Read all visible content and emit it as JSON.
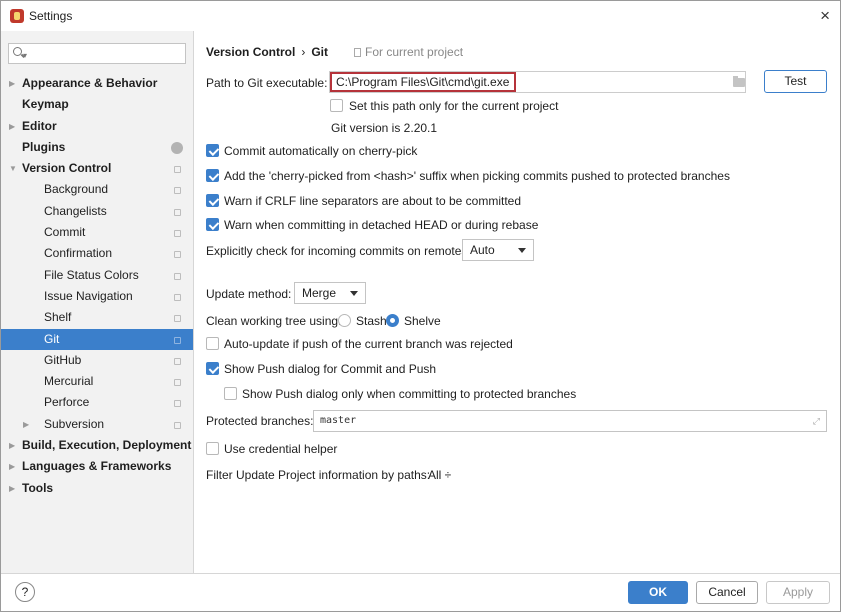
{
  "window": {
    "title": "Settings",
    "close_label": "×"
  },
  "search": {
    "placeholder": ""
  },
  "sidebar": {
    "items": [
      {
        "label": "Appearance & Behavior",
        "level": 0,
        "bold": true,
        "arrow": true
      },
      {
        "label": "Keymap",
        "level": 0,
        "bold": true,
        "arrow": false
      },
      {
        "label": "Editor",
        "level": 0,
        "bold": true,
        "arrow": true
      },
      {
        "label": "Plugins",
        "level": 0,
        "bold": true,
        "arrow": false
      },
      {
        "label": "Version Control",
        "level": 0,
        "bold": true,
        "arrow": true,
        "expanded": true
      },
      {
        "label": "Background",
        "level": 1
      },
      {
        "label": "Changelists",
        "level": 1
      },
      {
        "label": "Commit",
        "level": 1
      },
      {
        "label": "Confirmation",
        "level": 1
      },
      {
        "label": "File Status Colors",
        "level": 1
      },
      {
        "label": "Issue Navigation",
        "level": 1
      },
      {
        "label": "Shelf",
        "level": 1
      },
      {
        "label": "Git",
        "level": 1,
        "selected": true
      },
      {
        "label": "GitHub",
        "level": 1
      },
      {
        "label": "Mercurial",
        "level": 1
      },
      {
        "label": "Perforce",
        "level": 1
      },
      {
        "label": "Subversion",
        "level": 1,
        "arrow": true
      },
      {
        "label": "Build, Execution, Deployment",
        "level": 0,
        "bold": true,
        "arrow": true
      },
      {
        "label": "Languages & Frameworks",
        "level": 0,
        "bold": true,
        "arrow": true
      },
      {
        "label": "Tools",
        "level": 0,
        "bold": true,
        "arrow": true
      }
    ]
  },
  "breadcrumb": {
    "parent": "Version Control",
    "separator": "›",
    "current": "Git",
    "scope": "For current project"
  },
  "git": {
    "path_label": "Path to Git executable:",
    "path_value": "C:\\Program Files\\Git\\cmd\\git.exe",
    "test_button": "Test",
    "project_only_label": "Set this path only for the current project",
    "version_text": "Git version is 2.20.1"
  },
  "options": {
    "commit_cherry_pick": "Commit automatically on cherry-pick",
    "add_cherry_suffix": "Add the 'cherry-picked from <hash>' suffix when picking commits pushed to protected branches",
    "warn_crlf": "Warn if CRLF line separators are about to be committed",
    "warn_detached": "Warn when committing in detached HEAD or during rebase",
    "incoming_label": "Explicitly check for incoming commits on remotes:",
    "incoming_value": "Auto",
    "update_method_label": "Update method:",
    "update_method_value": "Merge",
    "clean_tree_label": "Clean working tree using:",
    "stash_label": "Stash",
    "shelve_label": "Shelve",
    "auto_update_label": "Auto-update if push of the current branch was rejected",
    "show_push_dialog": "Show Push dialog for Commit and Push",
    "show_push_protected": "Show Push dialog only when committing to protected branches",
    "protected_label": "Protected branches:",
    "protected_value": "master",
    "credential_helper": "Use credential helper",
    "filter_label": "Filter Update Project information by paths:",
    "filter_value": "All ÷"
  },
  "footer": {
    "help": "?",
    "ok": "OK",
    "cancel": "Cancel",
    "apply": "Apply"
  },
  "colors": {
    "accent": "#3b7fcb",
    "highlight_border": "#b5333a"
  }
}
